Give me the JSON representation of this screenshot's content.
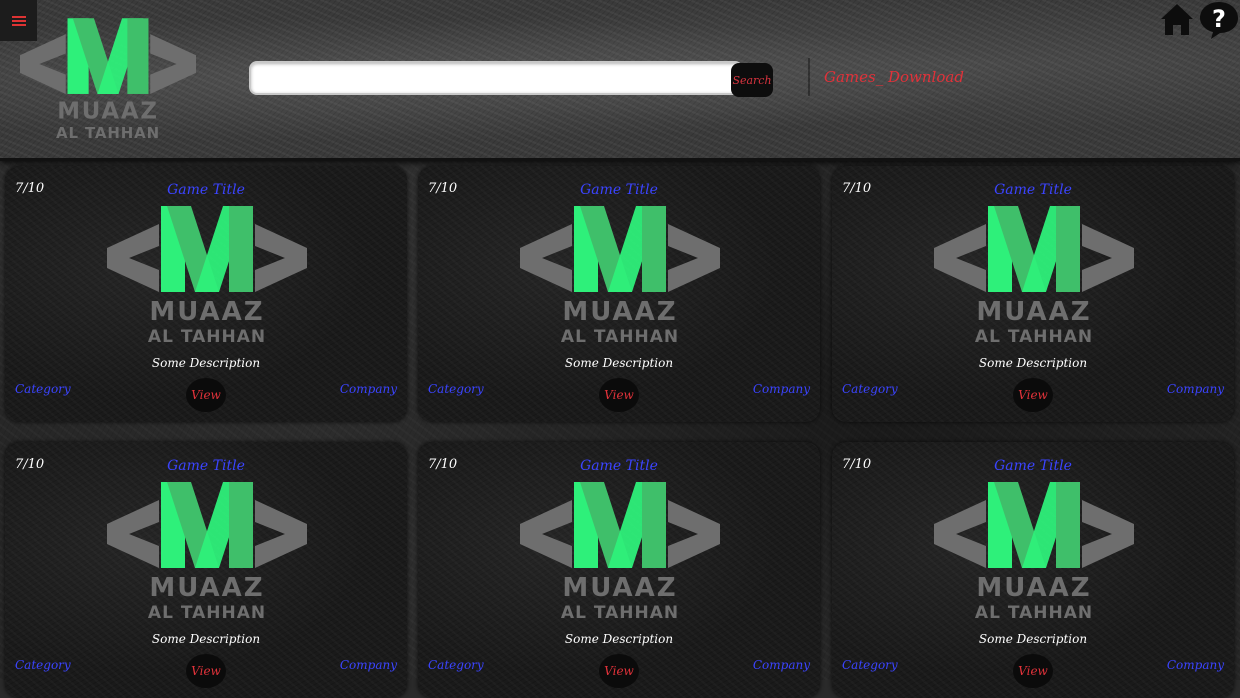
{
  "header": {
    "menu_icon": "hamburger-menu-icon",
    "logo": {
      "line1": "MUAAZ",
      "line2": "AL TAHHAN"
    },
    "search": {
      "placeholder": "",
      "value": "",
      "button_label": "Search"
    },
    "nav_link": "Games_ Download",
    "home_icon": "home-icon",
    "help_icon": "help-speech-bubble-icon"
  },
  "colors": {
    "accent_red": "#e0323a",
    "title_blue": "#3b44ff",
    "logo_green_light": "#2ef07a",
    "logo_green_dark": "#3fbf6a",
    "logo_gray": "#6e6e6e"
  },
  "cards": [
    {
      "rating": "7/10",
      "title": "Game Title",
      "logo": {
        "line1": "MUAAZ",
        "line2": "AL TAHHAN"
      },
      "description": "Some Description",
      "category": "Category",
      "company": "Company",
      "view_label": "View"
    },
    {
      "rating": "7/10",
      "title": "Game Title",
      "logo": {
        "line1": "MUAAZ",
        "line2": "AL TAHHAN"
      },
      "description": "Some Description",
      "category": "Category",
      "company": "Company",
      "view_label": "View"
    },
    {
      "rating": "7/10",
      "title": "Game Title",
      "logo": {
        "line1": "MUAAZ",
        "line2": "AL TAHHAN"
      },
      "description": "Some Description",
      "category": "Category",
      "company": "Company",
      "view_label": "View"
    },
    {
      "rating": "7/10",
      "title": "Game Title",
      "logo": {
        "line1": "MUAAZ",
        "line2": "AL TAHHAN"
      },
      "description": "Some Description",
      "category": "Category",
      "company": "Company",
      "view_label": "View"
    },
    {
      "rating": "7/10",
      "title": "Game Title",
      "logo": {
        "line1": "MUAAZ",
        "line2": "AL TAHHAN"
      },
      "description": "Some Description",
      "category": "Category",
      "company": "Company",
      "view_label": "View"
    },
    {
      "rating": "7/10",
      "title": "Game Title",
      "logo": {
        "line1": "MUAAZ",
        "line2": "AL TAHHAN"
      },
      "description": "Some Description",
      "category": "Category",
      "company": "Company",
      "view_label": "View"
    }
  ]
}
